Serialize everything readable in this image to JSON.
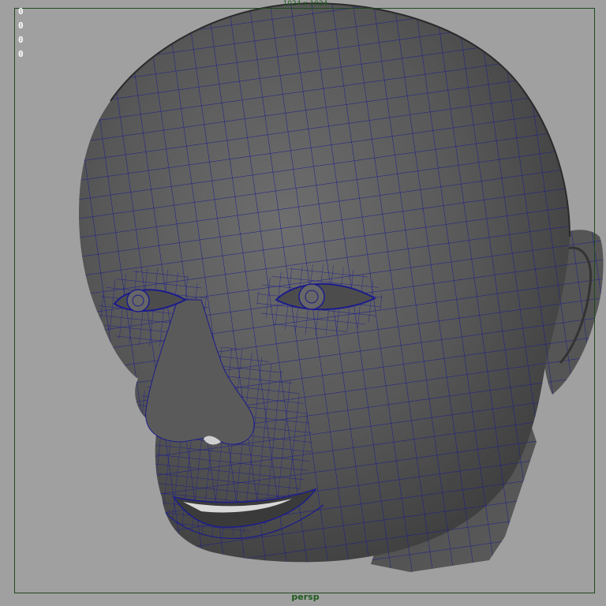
{
  "viewport": {
    "resolution_gate_label": "1024 x 1024",
    "camera_name": "persp",
    "hud_values": [
      "0",
      "0",
      "0",
      "0"
    ]
  },
  "colors": {
    "background": "#a0a0a0",
    "mesh_shading": "#5b5b5b",
    "wireframe": "#1c1c8c",
    "gate_border": "#1f4a1f",
    "hud_text": "#ffffff"
  },
  "icons": [
    "polygon-head-mesh"
  ]
}
